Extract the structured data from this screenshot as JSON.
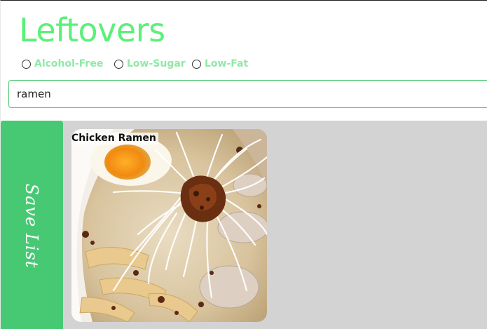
{
  "app": {
    "title": "Leftovers"
  },
  "filters": [
    {
      "label": "Alcohol-Free",
      "checked": false
    },
    {
      "label": "Low-Sugar",
      "checked": false
    },
    {
      "label": "Low-Fat",
      "checked": false
    }
  ],
  "search": {
    "value": "ramen"
  },
  "sidebar": {
    "save_label": "Save List"
  },
  "results": [
    {
      "title": "Chicken Ramen",
      "image": "ramen-bowl-photo"
    }
  ],
  "colors": {
    "accent": "#5cf07a",
    "filter_text": "#8fe9a5",
    "save_tab": "#47c974",
    "results_bg": "#d3d3d3"
  }
}
